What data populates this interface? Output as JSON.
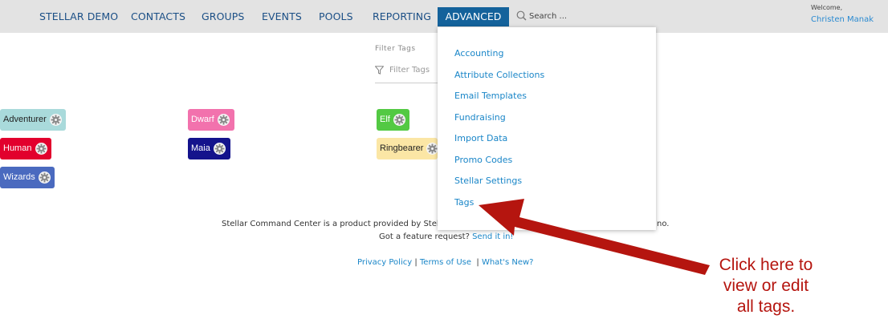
{
  "nav": {
    "items": [
      "STELLAR DEMO",
      "CONTACTS",
      "GROUPS",
      "EVENTS",
      "POOLS",
      "REPORTING"
    ],
    "active": "ADVANCED",
    "search_placeholder": "Search ...",
    "welcome": "Welcome,",
    "user": "Christen Manak"
  },
  "filter": {
    "title": "Filter Tags",
    "placeholder": "Filter Tags"
  },
  "tags": [
    {
      "label": "Adventurer",
      "bg": "#a9dadb",
      "text": "#222222"
    },
    {
      "label": "Dwarf",
      "bg": "#f272ad",
      "text": "#ffffff"
    },
    {
      "label": "Elf",
      "bg": "#53c943",
      "text": "#ffffff"
    },
    {
      "label": "Human",
      "bg": "#e2002d",
      "text": "#ffffff"
    },
    {
      "label": "Maia",
      "bg": "#14138c",
      "text": "#ffffff"
    },
    {
      "label": "Ringbearer",
      "bg": "#fbe6a5",
      "text": "#222222"
    },
    {
      "label": "Wizards",
      "bg": "#4a6abf",
      "text": "#ffffff"
    }
  ],
  "dropdown": {
    "items": [
      "Accounting",
      "Attribute Collections",
      "Email Templates",
      "Fundraising",
      "Import Data",
      "Promo Codes",
      "Stellar Settings",
      "Tags"
    ]
  },
  "footer": {
    "line1_start": "Stellar Command Center is a product provided by Stell",
    "line1_end": "no.",
    "request_text": "Got a feature request?",
    "request_link": "Send it in!",
    "privacy": "Privacy Policy",
    "sep1": " | ",
    "terms": "Terms of Use",
    "sep2": "  | ",
    "whats_new": "What's New?"
  },
  "annotation": {
    "line1": "Click here to",
    "line2": "view or edit",
    "line3": "all tags.",
    "color": "#b5150f"
  }
}
